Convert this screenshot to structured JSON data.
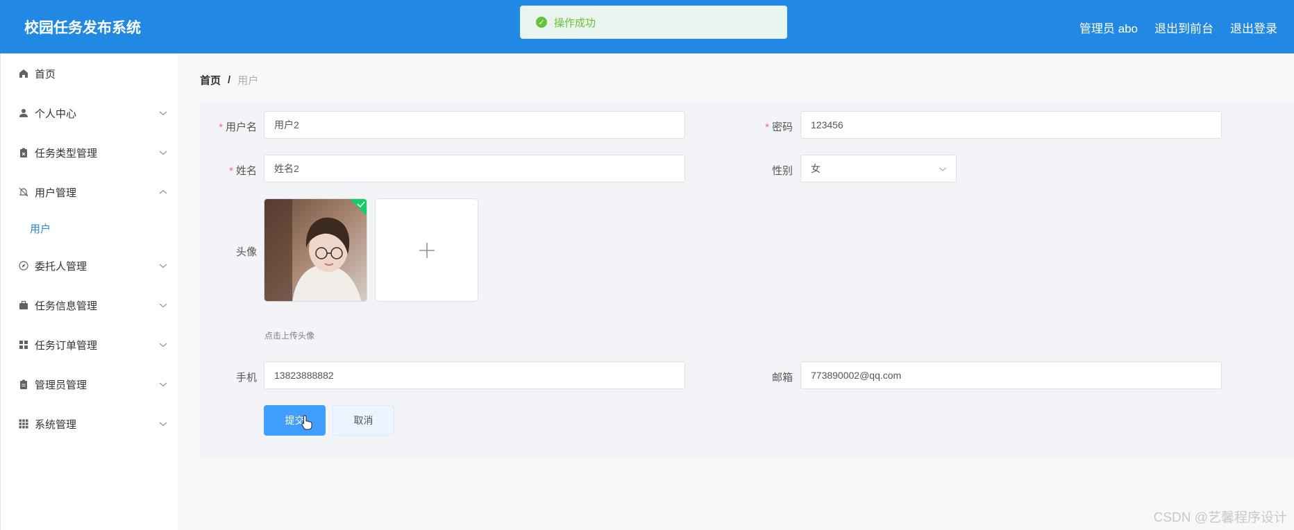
{
  "header": {
    "title": "校园任务发布系统",
    "admin_label": "管理员 abo",
    "frontend_link": "退出到前台",
    "logout_link": "退出登录"
  },
  "toast": {
    "message": "操作成功"
  },
  "sidebar": {
    "items": [
      {
        "label": "首页",
        "icon": "home-icon"
      },
      {
        "label": "个人中心",
        "icon": "user-icon"
      },
      {
        "label": "任务类型管理",
        "icon": "clipboard-icon"
      },
      {
        "label": "用户管理",
        "icon": "bell-icon"
      },
      {
        "label": "委托人管理",
        "icon": "compass-icon"
      },
      {
        "label": "任务信息管理",
        "icon": "briefcase-icon"
      },
      {
        "label": "任务订单管理",
        "icon": "grid-icon"
      },
      {
        "label": "管理员管理",
        "icon": "clipboard-icon"
      },
      {
        "label": "系统管理",
        "icon": "apps-icon"
      }
    ],
    "sub_item": "用户"
  },
  "breadcrumb": {
    "home": "首页",
    "separator": "/",
    "current": "用户"
  },
  "form": {
    "username_label": "用户名",
    "username_value": "用户2",
    "password_label": "密码",
    "password_value": "123456",
    "name_label": "姓名",
    "name_value": "姓名2",
    "gender_label": "性别",
    "gender_value": "女",
    "avatar_label": "头像",
    "upload_tip": "点击上传头像",
    "phone_label": "手机",
    "phone_value": "13823888882",
    "email_label": "邮箱",
    "email_value": "773890002@qq.com",
    "submit_label": "提交",
    "cancel_label": "取消"
  },
  "watermark": "CSDN @艺馨程序设计",
  "colors": {
    "header": "#2189e3",
    "primary": "#409eff",
    "success": "#67c23a",
    "required": "#f56c6c"
  }
}
